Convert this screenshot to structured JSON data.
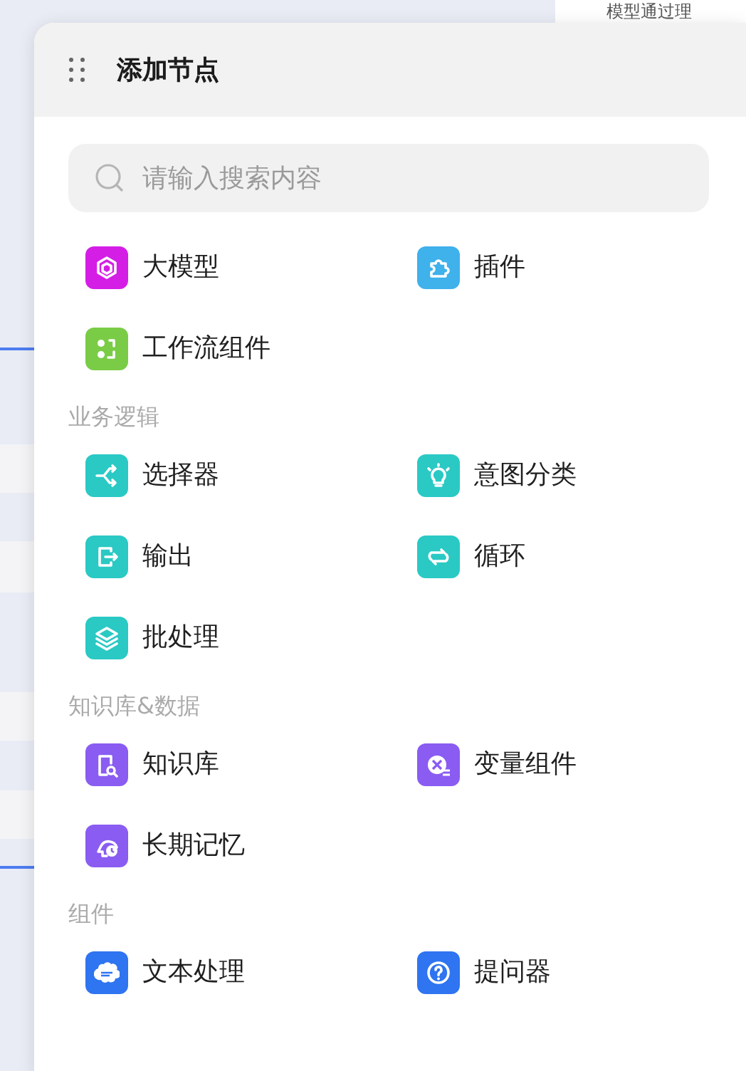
{
  "background": {
    "node_text": "模型通过理"
  },
  "panel": {
    "title": "添加节点",
    "search": {
      "placeholder": "请输入搜索内容"
    },
    "sections": [
      {
        "items": [
          {
            "label": "大模型",
            "color": "#d41ee6"
          },
          {
            "label": "插件",
            "color": "#3fb1eb"
          },
          {
            "label": "工作流组件",
            "color": "#7acc46"
          }
        ]
      },
      {
        "title": "业务逻辑",
        "items": [
          {
            "label": "选择器",
            "color": "#2ac9c4"
          },
          {
            "label": "意图分类",
            "color": "#2ac9c4"
          },
          {
            "label": "输出",
            "color": "#2ac9c4"
          },
          {
            "label": "循环",
            "color": "#2ac9c4"
          },
          {
            "label": "批处理",
            "color": "#2ac9c4"
          }
        ]
      },
      {
        "title": "知识库&数据",
        "items": [
          {
            "label": "知识库",
            "color": "#8a5cf2"
          },
          {
            "label": "变量组件",
            "color": "#8a5cf2"
          },
          {
            "label": "长期记忆",
            "color": "#8a5cf2"
          }
        ]
      },
      {
        "title": "组件",
        "items": [
          {
            "label": "文本处理",
            "color": "#2f74f0"
          },
          {
            "label": "提问器",
            "color": "#2f74f0"
          }
        ]
      }
    ]
  }
}
